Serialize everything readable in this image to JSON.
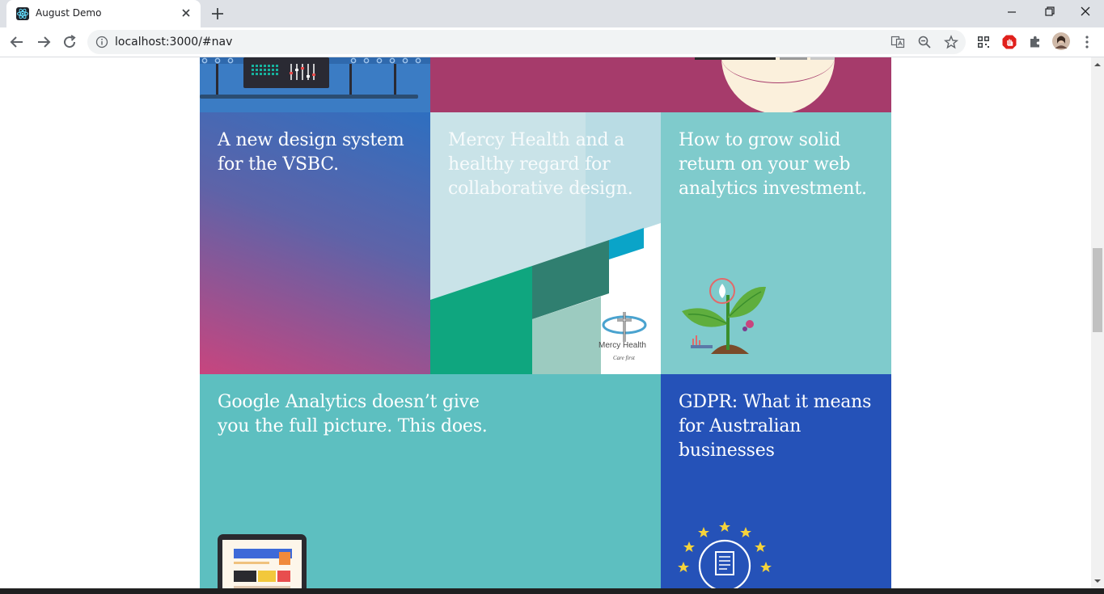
{
  "browser": {
    "tab_title": "August Demo",
    "url": "localhost:3000/#nav"
  },
  "tiles": [
    {
      "title": "A new design system for the VSBC."
    },
    {
      "title": "Mercy Health and a healthy regard for collaborative design."
    },
    {
      "title": "How to grow solid return on your web analytics investment."
    },
    {
      "title": "Google Analytics doesn’t give you the full picture. This does."
    },
    {
      "title": "GDPR: What it means for Australian businesses"
    }
  ],
  "mercy_logo": {
    "name": "Mercy Health",
    "tagline": "Care first"
  },
  "colors": {
    "vsbc_top": "#2e6fc0",
    "vsbc_bottom": "#c8457e",
    "magenta": "#a63b6b",
    "mercy_bg": "#c9e3e8",
    "analytics_teal": "#7fcbcc",
    "google_teal": "#5dbfc0",
    "gdpr_blue": "#2552b8"
  }
}
